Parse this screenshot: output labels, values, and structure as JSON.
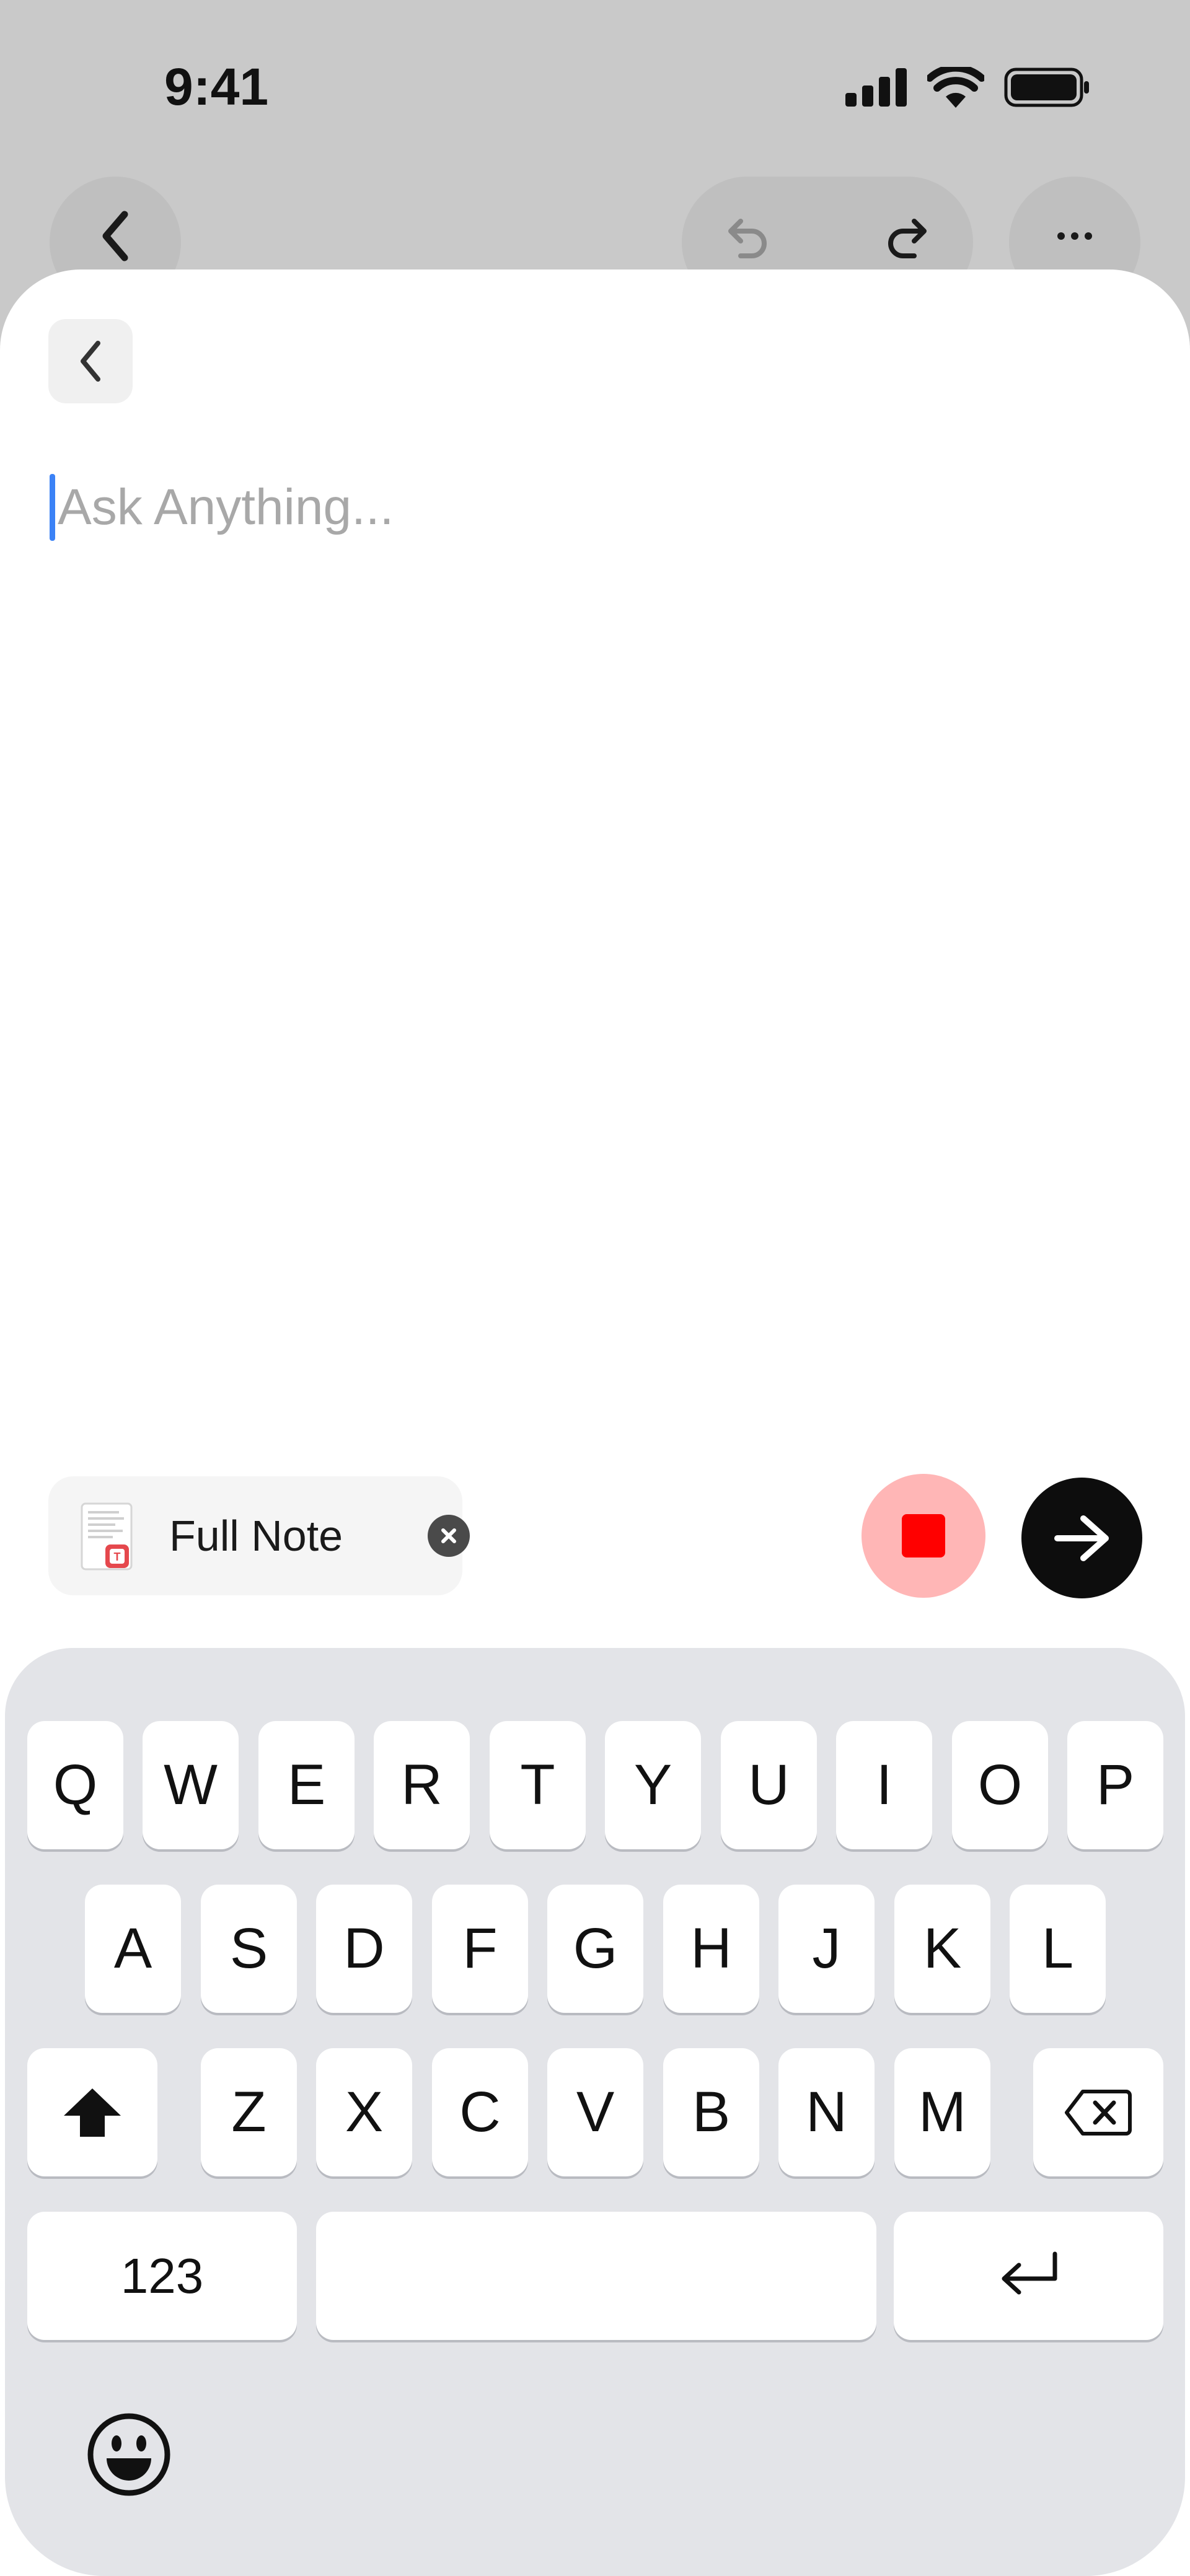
{
  "status_bar": {
    "time": "9:41"
  },
  "composer": {
    "placeholder": "Ask Anything...",
    "attachment_label": "Full Note"
  },
  "keyboard": {
    "row1": [
      "Q",
      "W",
      "E",
      "R",
      "T",
      "Y",
      "U",
      "I",
      "O",
      "P"
    ],
    "row2": [
      "A",
      "S",
      "D",
      "F",
      "G",
      "H",
      "J",
      "K",
      "L"
    ],
    "row3": [
      "Z",
      "X",
      "C",
      "V",
      "B",
      "N",
      "M"
    ],
    "numbers_label": "123"
  },
  "icons": {
    "status": [
      "cellular-signal-icon",
      "wifi-icon",
      "battery-icon"
    ],
    "toolbar": [
      "back-chevron-icon",
      "undo-icon",
      "redo-icon",
      "more-icon"
    ],
    "composer": [
      "note-document-icon",
      "close-circle-icon",
      "stop-icon",
      "arrow-right-icon"
    ],
    "keyboard": [
      "shift-icon",
      "backspace-icon",
      "return-icon",
      "emoji-icon"
    ]
  },
  "colors": {
    "caret": "#3b82f6",
    "stop_button_bg": "#ffb6b6",
    "stop_square": "#ff0000",
    "send_button_bg": "#0d0d0d",
    "keyboard_bg": "#e3e4e8"
  }
}
